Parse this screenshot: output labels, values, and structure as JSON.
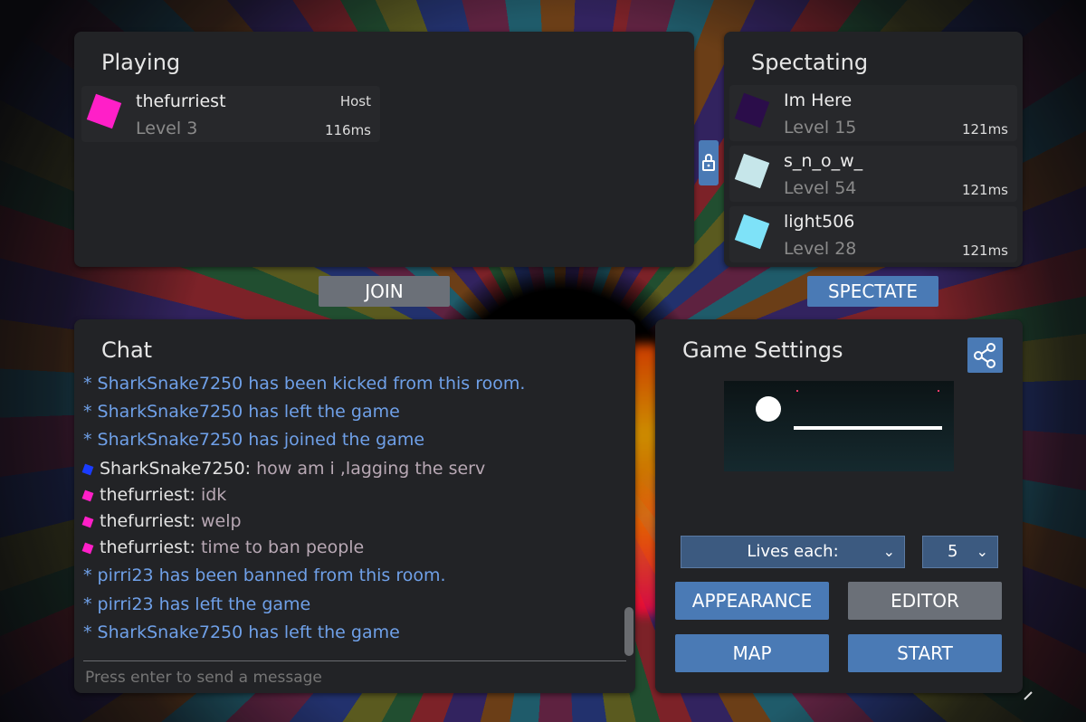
{
  "playing": {
    "title": "Playing",
    "players": [
      {
        "name": "thefurriest",
        "level": "Level 3",
        "role": "Host",
        "ping": "116ms",
        "color": "#ff1fc8"
      }
    ]
  },
  "spectating": {
    "title": "Spectating",
    "players": [
      {
        "name": "Im Here",
        "level": "Level 15",
        "ping": "121ms",
        "color": "#2b0d4a"
      },
      {
        "name": "s_n_o_w_",
        "level": "Level 54",
        "ping": "121ms",
        "color": "#c6e6ea"
      },
      {
        "name": "light506",
        "level": "Level 28",
        "ping": "121ms",
        "color": "#7ee2f8"
      }
    ]
  },
  "buttons": {
    "join": "JOIN",
    "spectate": "SPECTATE",
    "appearance": "APPEARANCE",
    "editor": "EDITOR",
    "map": "MAP",
    "start": "START"
  },
  "chat": {
    "title": "Chat",
    "placeholder": "Press enter to send a message",
    "messages": [
      {
        "type": "system",
        "text": "* SharkSnake7250 has been kicked from this room."
      },
      {
        "type": "system",
        "text": "* SharkSnake7250 has left the game"
      },
      {
        "type": "system",
        "text": "* SharkSnake7250 has joined the game"
      },
      {
        "type": "user",
        "user": "SharkSnake7250:",
        "text": " how am i ,lagging the serv",
        "color": "#1a3cff"
      },
      {
        "type": "user",
        "user": "thefurriest:",
        "text": " idk",
        "color": "#ff1fc8"
      },
      {
        "type": "user",
        "user": "thefurriest:",
        "text": " welp",
        "color": "#ff1fc8"
      },
      {
        "type": "user",
        "user": "thefurriest:",
        "text": " time to ban people",
        "color": "#ff1fc8"
      },
      {
        "type": "system",
        "text": "* pirri23 has been banned from this room."
      },
      {
        "type": "system",
        "text": "* pirri23 has left the game"
      },
      {
        "type": "system",
        "text": "* SharkSnake7250 has left the game"
      }
    ]
  },
  "settings": {
    "title": "Game Settings",
    "mode_label": "Lives each:",
    "mode_value": "5"
  },
  "icons": {
    "lock": "lock-icon",
    "share": "share-icon",
    "chevron": "chevron-down-icon"
  }
}
